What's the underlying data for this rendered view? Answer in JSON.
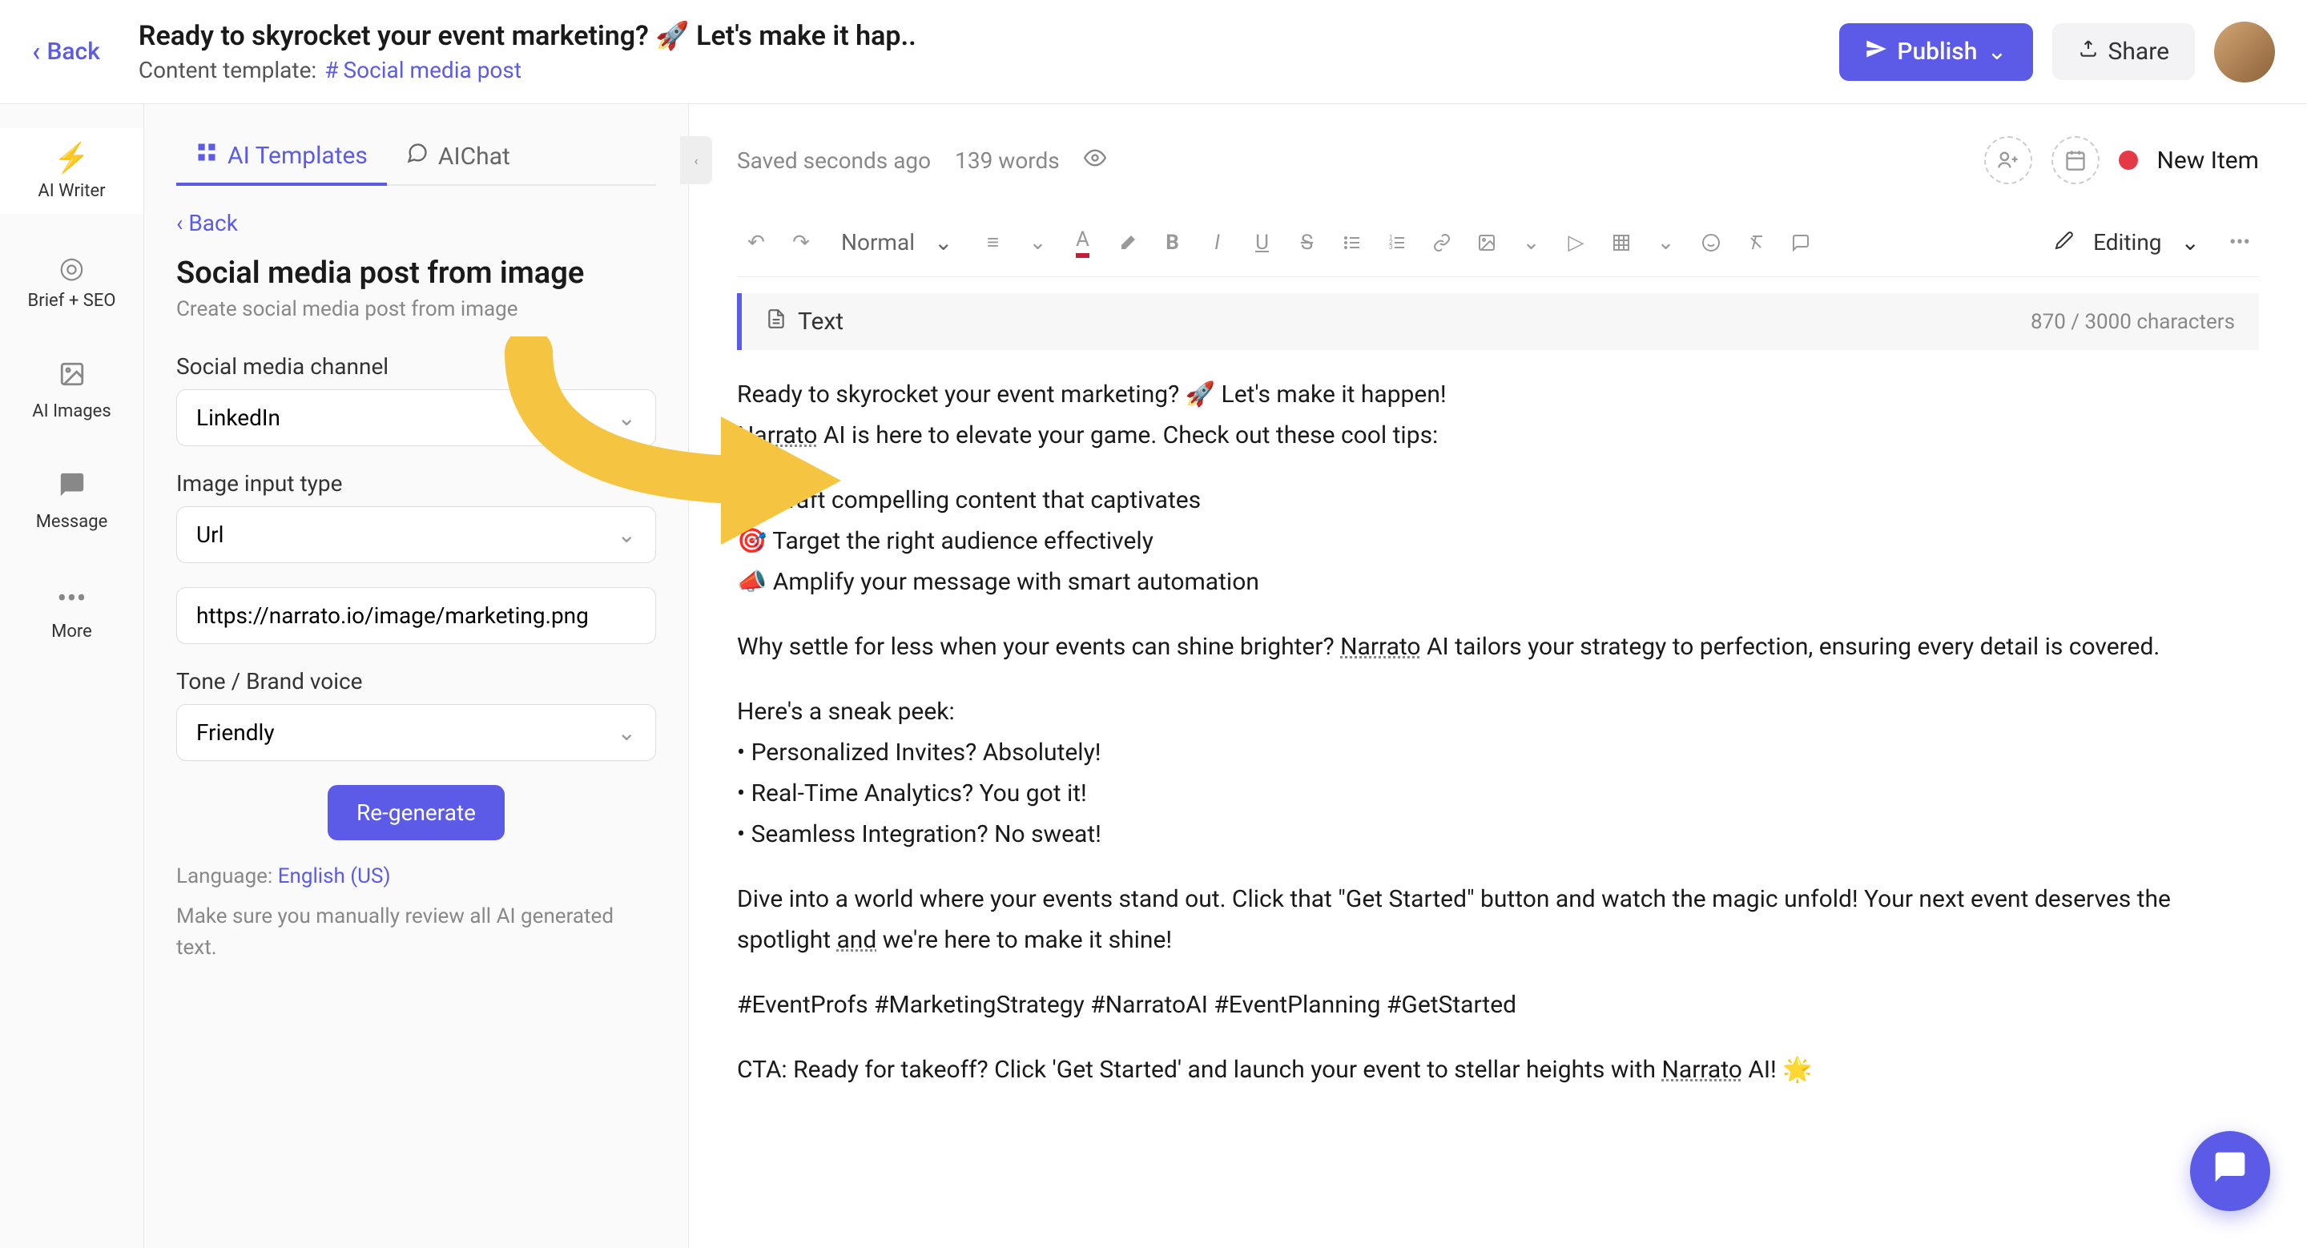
{
  "header": {
    "back_label": "Back",
    "title": "Ready to skyrocket your event marketing? 🚀 Let's make it hap..",
    "template_label": "Content template:",
    "template_name": "Social media post",
    "publish_label": "Publish",
    "share_label": "Share"
  },
  "rail": {
    "items": [
      {
        "label": "AI Writer"
      },
      {
        "label": "Brief + SEO"
      },
      {
        "label": "AI Images"
      },
      {
        "label": "Message"
      },
      {
        "label": "More"
      }
    ]
  },
  "sidebar": {
    "tabs": [
      {
        "label": "AI Templates"
      },
      {
        "label": "AIChat"
      }
    ],
    "back_label": "Back",
    "panel_title": "Social media post from image",
    "panel_subtitle": "Create social media post from image",
    "channel_label": "Social media channel",
    "channel_value": "LinkedIn",
    "input_type_label": "Image input type",
    "input_type_value": "Url",
    "url_value": "https://narrato.io/image/marketing.png",
    "tone_label": "Tone / Brand voice",
    "tone_value": "Friendly",
    "regenerate_label": "Re-generate",
    "language_label": "Language:",
    "language_value": "English (US)",
    "review_text": "Make sure you manually review all AI generated text."
  },
  "editor": {
    "saved_label": "Saved seconds ago",
    "word_count": "139 words",
    "new_item_label": "New Item",
    "format_label": "Normal",
    "editing_label": "Editing",
    "text_label": "Text",
    "char_count": "870 / 3000 characters",
    "content": {
      "line1": "Ready to skyrocket your event marketing? 🚀 Let's make it happen!",
      "line2a": "Narrato",
      "line2b": " AI is here to elevate your game. Check out these cool tips:",
      "bullet1": "🔥 Craft compelling content that captivates",
      "bullet2": "🎯 Target the right audience effectively",
      "bullet3": "📣 Amplify your message with smart automation",
      "para2a": "Why settle for less when your events can shine brighter? ",
      "para2b": "Narrato",
      "para2c": " AI tailors your strategy to perfection, ensuring every detail is covered.",
      "peek_header": "Here's a sneak peek:",
      "peek1": "• Personalized Invites? Absolutely!",
      "peek2": "• Real-Time Analytics? You got it!",
      "peek3": "• Seamless Integration? No sweat!",
      "para3a": "Dive into a world where your events stand out. Click that \"Get Started\" button and watch the magic unfold! Your next event deserves the spotlight ",
      "para3b": "and",
      "para3c": " we're here to make it shine!",
      "hashtags": "#EventProfs #MarketingStrategy #NarratoAI #EventPlanning #GetStarted",
      "cta_a": "CTA: Ready for takeoff? Click 'Get Started' and launch your event to stellar heights with ",
      "cta_b": "Narrato",
      "cta_c": " AI! 🌟"
    }
  }
}
